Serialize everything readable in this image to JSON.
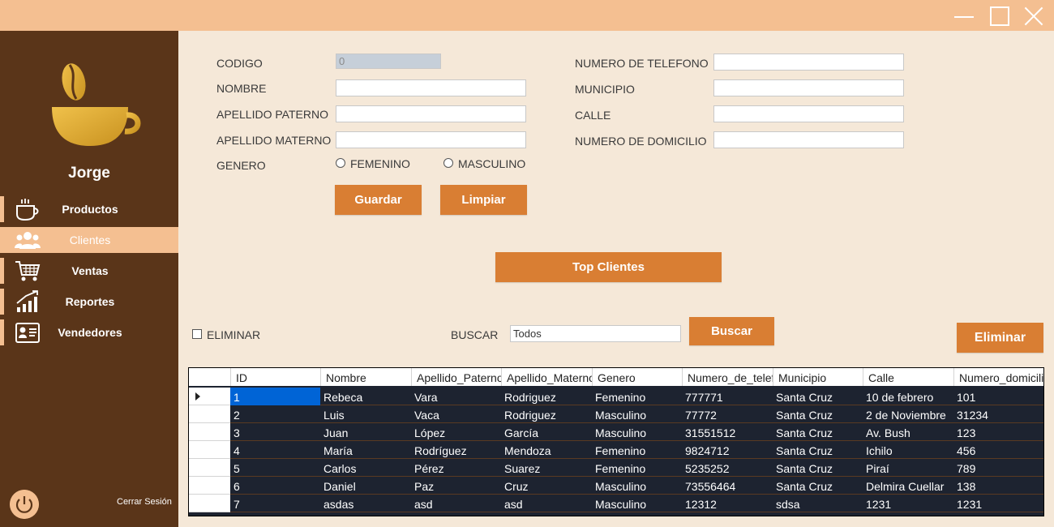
{
  "window": {
    "controls": [
      "minimize",
      "maximize",
      "close"
    ]
  },
  "sidebar": {
    "username": "Jorge",
    "items": [
      {
        "label": "Productos",
        "icon": "coffee-cup-icon"
      },
      {
        "label": "Clientes",
        "icon": "users-icon",
        "active": true
      },
      {
        "label": "Ventas",
        "icon": "shopping-cart-icon"
      },
      {
        "label": "Reportes",
        "icon": "bar-chart-icon"
      },
      {
        "label": "Vendedores",
        "icon": "id-card-icon"
      }
    ],
    "logout_label": "Cerrar Sesión"
  },
  "form": {
    "codigo_label": "CODIGO",
    "codigo_value": "0",
    "nombre_label": "NOMBRE",
    "apellido_paterno_label": "APELLIDO PATERNO",
    "apellido_materno_label": "APELLIDO MATERNO",
    "genero_label": "GENERO",
    "femenino_label": "FEMENINO",
    "masculino_label": "MASCULINO",
    "telefono_label": "NUMERO DE TELEFONO",
    "municipio_label": "MUNICIPIO",
    "calle_label": "CALLE",
    "domicilio_label": "NUMERO DE DOMICILIO",
    "guardar_label": "Guardar",
    "limpiar_label": "Limpiar"
  },
  "top_clientes_label": "Top Clientes",
  "search": {
    "eliminar_check_label": "ELIMINAR",
    "buscar_label": "BUSCAR",
    "buscar_value": "Todos",
    "buscar_button": "Buscar",
    "eliminar_button": "Eliminar"
  },
  "grid": {
    "columns": [
      "ID",
      "Nombre",
      "Apellido_Paterno",
      "Apellido_Materno",
      "Genero",
      "Numero_de_telefono",
      "Municipio",
      "Calle",
      "Numero_domicilio"
    ],
    "rows": [
      [
        "1",
        "Rebeca",
        "Vara",
        "Rodriguez",
        "Femenino",
        "777771",
        "Santa Cruz",
        "10 de febrero",
        "101"
      ],
      [
        "2",
        "Luis",
        "Vaca",
        "Rodriguez",
        "Masculino",
        "77772",
        "Santa Cruz",
        "2 de Noviembre",
        "31234"
      ],
      [
        "3",
        "Juan",
        "López",
        "García",
        "Masculino",
        "31551512",
        "Santa Cruz",
        "Av. Bush",
        "123"
      ],
      [
        "4",
        "María",
        "Rodríguez",
        "Mendoza",
        "Femenino",
        "9824712",
        "Santa Cruz",
        "Ichilo",
        "456"
      ],
      [
        "5",
        "Carlos",
        "Pérez",
        "Suarez",
        "Femenino",
        "5235252",
        "Santa Cruz",
        "Piraí",
        "789"
      ],
      [
        "6",
        "Daniel",
        "Paz",
        "Cruz",
        "Masculino",
        "73556464",
        "Santa Cruz",
        "Delmira Cuellar",
        "138"
      ],
      [
        "7",
        "asdas",
        "asd",
        "asd",
        "Masculino",
        "12312",
        "sdsa",
        "1231",
        "1231"
      ]
    ]
  },
  "colors": {
    "titlebar": "#f4bf91",
    "sidebar": "#5a3519",
    "content_bg": "#f5e8d8",
    "button": "#d97e33",
    "grid_bg": "#1d2330",
    "selection": "#0064d6"
  }
}
